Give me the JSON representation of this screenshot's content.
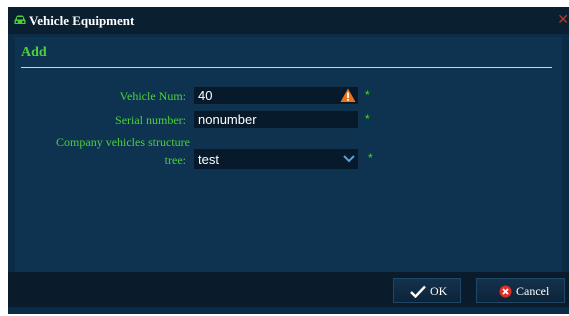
{
  "dialog": {
    "title": "Vehicle Equipment",
    "close_glyph": "✕",
    "title_icon": "car-icon"
  },
  "section": {
    "title": "Add"
  },
  "form": {
    "vehicle_num": {
      "label": "Vehicle Num:",
      "value": "40",
      "required": "*",
      "warning_icon": "warning-icon"
    },
    "serial_number": {
      "label": "Serial number:",
      "value": "nonumber",
      "required": "*"
    },
    "structure_tree": {
      "label_line1": "Company vehicles structure",
      "label_line2": "tree:",
      "value": "test",
      "required": "*",
      "dropdown_icon": "chevron-down-icon"
    }
  },
  "buttons": {
    "ok": {
      "label": "OK",
      "icon": "checkmark-icon"
    },
    "cancel": {
      "label": "Cancel",
      "icon": "cancel-icon"
    }
  },
  "colors": {
    "accent_green": "#4cd13a",
    "dialog_bg": "#0b2c47",
    "input_bg": "#071a2b",
    "warning_orange": "#e8741e",
    "cancel_red": "#d9302c"
  }
}
